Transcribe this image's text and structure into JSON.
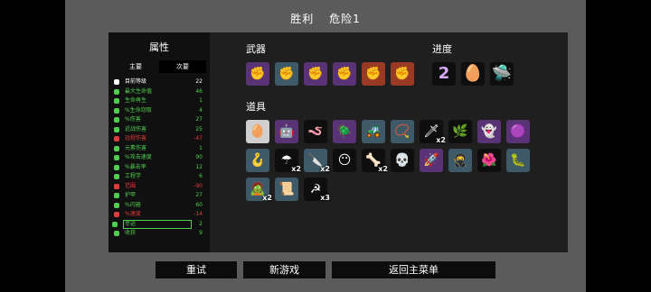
{
  "title": {
    "result": "胜利",
    "danger": "危险1"
  },
  "stats": {
    "heading": "属性",
    "tab_main": "主要",
    "tab_secondary": "次要",
    "rows": [
      {
        "icon": "level-icon",
        "color": "#ffffff",
        "label": "目前等级",
        "value": "22",
        "label_color": "#ffffff",
        "value_color": "#ffffff"
      },
      {
        "icon": "heart-icon",
        "color": "#4fce4f",
        "label": "最大生命值",
        "value": "46",
        "label_color": "#4fce4f",
        "value_color": "#4fce4f"
      },
      {
        "icon": "regen-icon",
        "color": "#4fce4f",
        "label": "生命再生",
        "value": "1",
        "label_color": "#4fce4f",
        "value_color": "#4fce4f"
      },
      {
        "icon": "lifesteal-icon",
        "color": "#4fce4f",
        "label": "%生命窃取",
        "value": "4",
        "label_color": "#4fce4f",
        "value_color": "#4fce4f"
      },
      {
        "icon": "damage-icon",
        "color": "#4fce4f",
        "label": "%伤害",
        "value": "27",
        "label_color": "#4fce4f",
        "value_color": "#4fce4f"
      },
      {
        "icon": "melee-icon",
        "color": "#4fce4f",
        "label": "近战伤害",
        "value": "25",
        "label_color": "#4fce4f",
        "value_color": "#4fce4f"
      },
      {
        "icon": "ranged-icon",
        "color": "#e23b3b",
        "label": "远程伤害",
        "value": "-47",
        "label_color": "#e23b3b",
        "value_color": "#e23b3b"
      },
      {
        "icon": "elemental-icon",
        "color": "#4fce4f",
        "label": "元素伤害",
        "value": "1",
        "label_color": "#4fce4f",
        "value_color": "#4fce4f"
      },
      {
        "icon": "attack-speed-icon",
        "color": "#4fce4f",
        "label": "%攻击速度",
        "value": "90",
        "label_color": "#4fce4f",
        "value_color": "#4fce4f"
      },
      {
        "icon": "crit-icon",
        "color": "#4fce4f",
        "label": "%暴击率",
        "value": "12",
        "label_color": "#4fce4f",
        "value_color": "#4fce4f"
      },
      {
        "icon": "engineering-icon",
        "color": "#4fce4f",
        "label": "工程学",
        "value": "6",
        "label_color": "#4fce4f",
        "value_color": "#4fce4f"
      },
      {
        "icon": "range-icon",
        "color": "#e23b3b",
        "label": "范围",
        "value": "-90",
        "label_color": "#e23b3b",
        "value_color": "#e23b3b"
      },
      {
        "icon": "armor-icon",
        "color": "#4fce4f",
        "label": "护甲",
        "value": "27",
        "label_color": "#4fce4f",
        "value_color": "#4fce4f"
      },
      {
        "icon": "dodge-icon",
        "color": "#4fce4f",
        "label": "%闪避",
        "value": "60",
        "label_color": "#4fce4f",
        "value_color": "#4fce4f"
      },
      {
        "icon": "speed-icon",
        "color": "#e23b3b",
        "label": "%速度",
        "value": "-14",
        "label_color": "#e23b3b",
        "value_color": "#e23b3b"
      },
      {
        "icon": "luck-icon",
        "color": "#4fce4f",
        "label": "幸运",
        "value": "2",
        "label_color": "#4fce4f",
        "value_color": "#4fce4f"
      },
      {
        "icon": "harvest-icon",
        "color": "#4fce4f",
        "label": "收获",
        "value": "9",
        "label_color": "#4fce4f",
        "value_color": "#4fce4f"
      }
    ]
  },
  "weapons": {
    "heading": "武器",
    "items": [
      {
        "icon": "fist-icon",
        "glyph": "✊",
        "tier": "t3"
      },
      {
        "icon": "fist-icon",
        "glyph": "✊",
        "tier": "t2"
      },
      {
        "icon": "fist-icon",
        "glyph": "✊",
        "tier": "t3"
      },
      {
        "icon": "fist-icon",
        "glyph": "✊",
        "tier": "t3"
      },
      {
        "icon": "flaming-fist-icon",
        "glyph": "✊",
        "tier": "t4"
      },
      {
        "icon": "flaming-fist-icon",
        "glyph": "✊",
        "tier": "t4"
      }
    ]
  },
  "progress": {
    "heading": "进度",
    "items": [
      {
        "icon": "level-number-icon",
        "glyph": "2",
        "tier": "t0",
        "text_color": "#d7a9ff"
      },
      {
        "icon": "egg-icon",
        "glyph": "🥚",
        "tier": "t0",
        "text_color": "#ffffff"
      },
      {
        "icon": "ufo-icon",
        "glyph": "🛸",
        "tier": "t0",
        "text_color": "#ffffff"
      }
    ]
  },
  "items": {
    "heading": "道具",
    "rows": [
      [
        {
          "icon": "egg-icon",
          "glyph": "🥚",
          "tier": "t1",
          "qty": ""
        },
        {
          "icon": "robot-icon",
          "glyph": "🤖",
          "tier": "t3",
          "qty": ""
        },
        {
          "icon": "worm-icon",
          "glyph": "🪱",
          "tier": "t0",
          "qty": ""
        },
        {
          "icon": "scarab-icon",
          "glyph": "🪲",
          "tier": "t3",
          "qty": ""
        },
        {
          "icon": "tank-icon",
          "glyph": "🚜",
          "tier": "t2",
          "qty": ""
        },
        {
          "icon": "necklace-icon",
          "glyph": "📿",
          "tier": "t2",
          "qty": ""
        },
        {
          "icon": "knife-icon",
          "glyph": "🗡",
          "tier": "t0",
          "qty": "x2"
        },
        {
          "icon": "plant-icon",
          "glyph": "🌿",
          "tier": "t0",
          "qty": ""
        },
        {
          "icon": "ghost-icon",
          "glyph": "👻",
          "tier": "t3",
          "qty": ""
        },
        {
          "icon": "blob-icon",
          "glyph": "🟣",
          "tier": "t3",
          "qty": ""
        }
      ],
      [
        {
          "icon": "claw-icon",
          "glyph": "🪝",
          "tier": "t2",
          "qty": ""
        },
        {
          "icon": "umbrella-icon",
          "glyph": "☂",
          "tier": "t0",
          "qty": "x2"
        },
        {
          "icon": "cleaver-icon",
          "glyph": "🔪",
          "tier": "t2",
          "qty": "x2"
        },
        {
          "icon": "bearded-face-icon",
          "glyph": "😶",
          "tier": "t0",
          "qty": ""
        },
        {
          "icon": "bone-icon",
          "glyph": "🦴",
          "tier": "t0",
          "qty": "x2"
        },
        {
          "icon": "skull-icon",
          "glyph": "💀",
          "tier": "t0",
          "qty": ""
        },
        {
          "icon": "rocket-icon",
          "glyph": "🚀",
          "tier": "t3",
          "qty": ""
        },
        {
          "icon": "bandit-icon",
          "glyph": "🥷",
          "tier": "t2",
          "qty": ""
        },
        {
          "icon": "flower-icon",
          "glyph": "🌺",
          "tier": "t0",
          "qty": ""
        },
        {
          "icon": "worm-armor-icon",
          "glyph": "🐛",
          "tier": "t2",
          "qty": ""
        }
      ],
      [
        {
          "icon": "zombie-icon",
          "glyph": "🧟",
          "tier": "t2",
          "qty": "x2"
        },
        {
          "icon": "scroll-icon",
          "glyph": "📜",
          "tier": "t2",
          "qty": ""
        },
        {
          "icon": "scythe-icon",
          "glyph": "☭",
          "tier": "t0",
          "qty": "x3"
        }
      ]
    ]
  },
  "buttons": {
    "retry": "重试",
    "new_game": "新游戏",
    "main_menu": "返回主菜单"
  }
}
